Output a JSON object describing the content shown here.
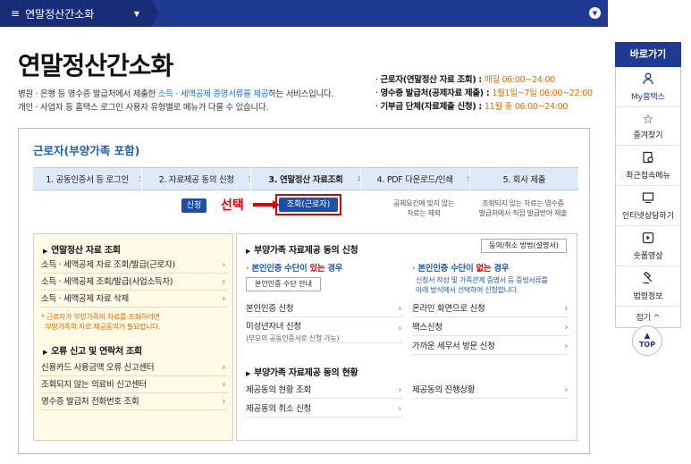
{
  "topbar": {
    "menu_icon": "hamburger-icon",
    "title": "연말정산간소화"
  },
  "page": {
    "title": "연말정산간소화",
    "desc_line1_a": "병원 · 은행 등 영수증 발급처에서 제출한 ",
    "desc_line1_hl": "소득 · 세액공제 증명서류를 제공",
    "desc_line1_b": "하는 서비스입니다.",
    "desc_line2": "개인 · 사업자 등 홈택스 로그인 사용자 유형별로 메뉴가 다를 수 있습니다."
  },
  "notice": [
    {
      "label": "근로자(연말정산 자료 조회) : ",
      "plain": "매일 ",
      "time": "06:00~24:00"
    },
    {
      "label": "영수증 발급처(공제자료 제출) : ",
      "plain": "1월1일~7일 ",
      "time": "06:00~22:00"
    },
    {
      "label": "기부금 단체(자료제출 신청) : ",
      "plain": "11월 중 ",
      "time": "06:00~24:00"
    }
  ],
  "sidebar": {
    "title": "바로가기",
    "items": [
      {
        "label": "My홈택스",
        "icon": "person-icon"
      },
      {
        "label": "즐겨찾기",
        "icon": "star-icon"
      },
      {
        "label": "최근접속메뉴",
        "icon": "recent-icon"
      },
      {
        "label": "인터넷상담하기",
        "icon": "monitor-icon"
      },
      {
        "label": "숏폼영상",
        "icon": "play-icon"
      },
      {
        "label": "법령정보",
        "icon": "gavel-icon"
      }
    ],
    "fold": "접기 ^",
    "top": "TOP"
  },
  "card": {
    "title": "근로자(부양가족 포함)",
    "steps": [
      "1. 공동인증서 등 로그인",
      "2. 자료제공 동의 신청",
      "3. 연말정산 자료조회",
      "4. PDF 다운로드/인쇄",
      "5. 회사 제출"
    ],
    "step4_sub": "공제요건에 맞지 않는\n자료는 제외",
    "step5_sub": "조회되지 않는 자료는 영수증\n발급처에서 직접 발급받아 제출",
    "apply_button": "신청",
    "select_label": "선택",
    "view_button": "조회(근로자)"
  },
  "left_panel": {
    "title1": "연말정산 자료 조회",
    "items1": [
      "소득 · 세액공제 자료 조회/발급(근로자)",
      "소득 · 세액공제 조회/발급(사업소득자)",
      "소득 · 세액공제 자료 삭제"
    ],
    "note": "* 근로자가 부양가족의 자료를 조회하려면\n  부양가족의 자료 제공동의가 필요합니다.",
    "title2": "오류 신고 및 연락처 조회",
    "items2": [
      "신용카드 사용금액 오류 신고센터",
      "조회되지 않는 의료비 신고센터",
      "영수증 발급처 전화번호 조회"
    ]
  },
  "right_panel": {
    "title1": "부양가족 자료제공 동의 신청",
    "method_button": "동의/취소 방법(설명서)",
    "auth_yes_a": "본인인증 수단이 ",
    "auth_yes_b": "있는",
    "auth_yes_c": " 경우",
    "auth_guide_button": "본인인증 수단 안내",
    "auth_no_a": "본인인증 수단이 ",
    "auth_no_b": "없는",
    "auth_no_c": " 경우",
    "auth_no_desc": "신청서 작성 및 가족관계 증명서 등 증빙서류를\n아래 방식에서 선택하여 신청합니다.",
    "left_items": [
      {
        "label": "본인인증 신청",
        "sub": ""
      },
      {
        "label": "미성년자녀 신청",
        "sub": "(부모의 공동인증서로 신청 가능)"
      }
    ],
    "right_items": [
      "온라인 화면으로 신청",
      "팩스신청",
      "가까운 세무서 방문 신청"
    ],
    "title2": "부양가족 자료제공 동의 현황",
    "status_left": [
      "제공동의 현황 조회",
      "제공동의 취소 신청"
    ],
    "status_right": [
      "제공동의 진행상황"
    ]
  }
}
